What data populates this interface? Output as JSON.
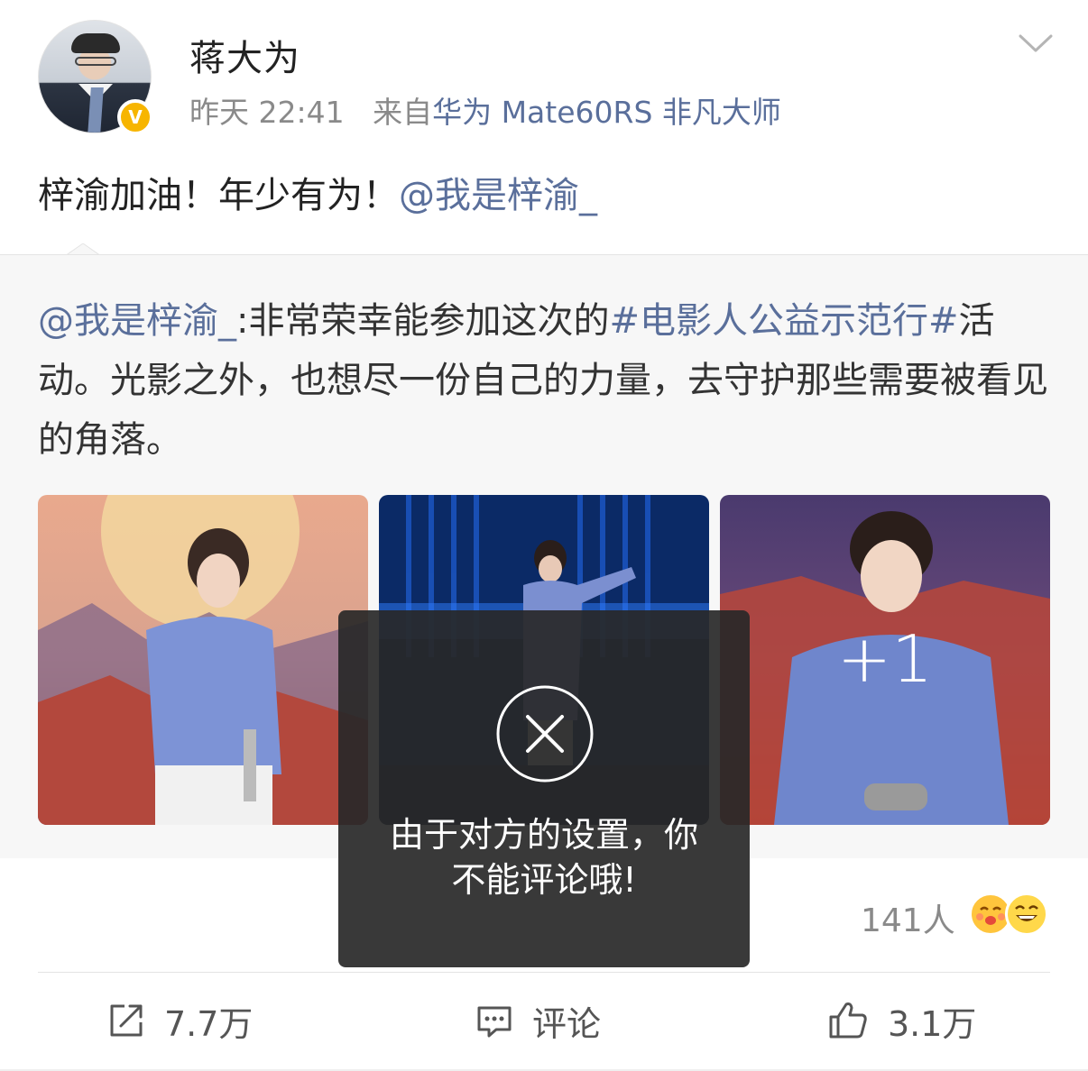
{
  "post": {
    "username": "蒋大为",
    "time": "昨天 22:41",
    "source_prefix": "来自",
    "source_device": "华为 Mate60RS 非凡大师",
    "text": "梓渝加油！年少有为！",
    "mention": "@我是梓渝_"
  },
  "repost": {
    "author": "@我是梓渝_",
    "separator": ":",
    "text_part1": "非常荣幸能参加这次的",
    "hashtag": "#电影人公益示范行#",
    "text_part2": "活动。光影之外，也想尽一份自己的力量，去守护那些需要被看见的角落。",
    "more_images": "+1"
  },
  "stats": {
    "like_people": "141人"
  },
  "actions": {
    "share_count": "7.7万",
    "comment_label": "评论",
    "like_count": "3.1万"
  },
  "toast": {
    "message_line1": "由于对方的设置，你",
    "message_line2": "不能评论哦!"
  },
  "colors": {
    "link": "#5a6f9b",
    "verified": "#f7b500",
    "toast_bg": "#282828"
  }
}
